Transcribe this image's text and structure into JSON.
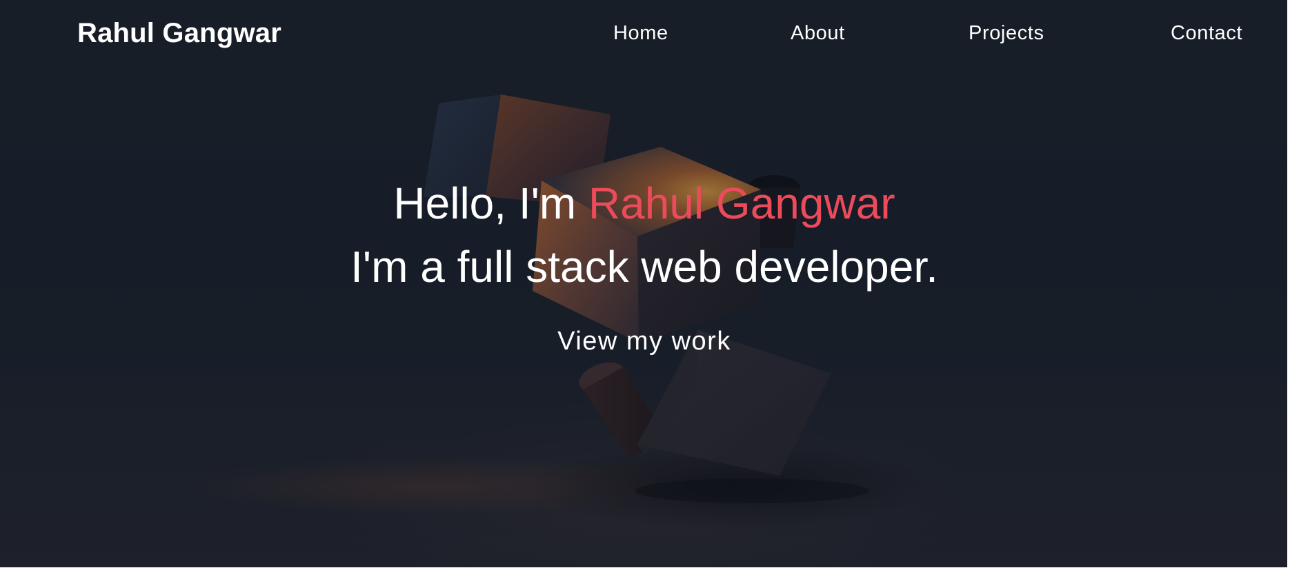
{
  "header": {
    "brand": "Rahul Gangwar",
    "nav": [
      {
        "label": "Home"
      },
      {
        "label": "About"
      },
      {
        "label": "Projects"
      },
      {
        "label": "Contact"
      }
    ]
  },
  "hero": {
    "greeting_prefix": "Hello, I'm ",
    "greeting_name": "Rahul Gangwar",
    "tagline": "I'm a full stack web developer.",
    "cta_label": "View my work"
  },
  "colors": {
    "background": "#1a212b",
    "text": "#ffffff",
    "accent": "#ec4b5b"
  }
}
